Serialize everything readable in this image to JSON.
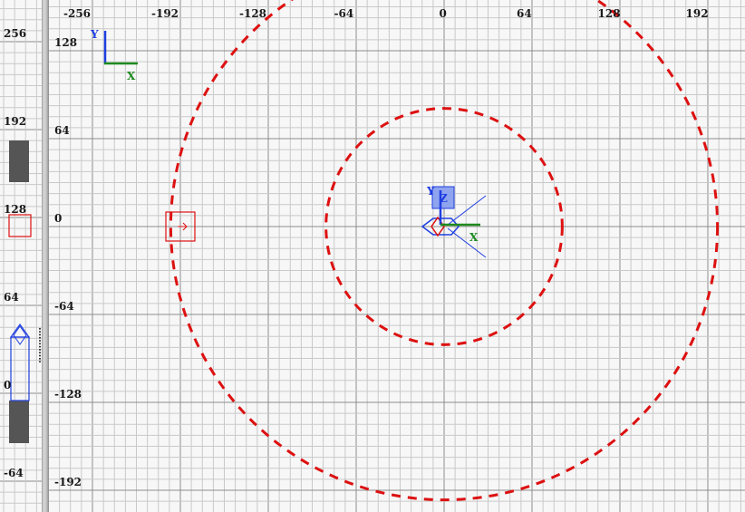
{
  "colors": {
    "background": "#f7f7f7",
    "minor_grid": "#c9c9c9",
    "major_grid": "#8c8c8c",
    "ring": "#dd1111",
    "camera": "#1f3fe0",
    "axis_y": "#1f3fe0",
    "axis_x": "#1f8a1f",
    "block": "#555555"
  },
  "main_view": {
    "x_ticks": [
      {
        "value": -256,
        "label": "-256"
      },
      {
        "value": -192,
        "label": "-192"
      },
      {
        "value": -128,
        "label": "-128"
      },
      {
        "value": -64,
        "label": "-64"
      },
      {
        "value": 0,
        "label": "0"
      },
      {
        "value": 64,
        "label": "64"
      },
      {
        "value": 128,
        "label": "128"
      },
      {
        "value": 192,
        "label": "192"
      }
    ],
    "y_ticks": [
      {
        "value": 128,
        "label": "128"
      },
      {
        "value": 64,
        "label": "64"
      },
      {
        "value": 0,
        "label": "0"
      },
      {
        "value": -64,
        "label": "-64"
      },
      {
        "value": -128,
        "label": "-128"
      },
      {
        "value": -192,
        "label": "-192"
      }
    ],
    "axis_legend": {
      "y": "Y",
      "x": "X"
    },
    "camera_axis": {
      "y": "Y",
      "x": "X",
      "z": "Z"
    },
    "inner_ring_radius": 86,
    "outer_ring_radius": 199,
    "light_position": [
      -192,
      0
    ]
  },
  "side_view": {
    "y_ticks": [
      {
        "value": 256,
        "label": "256"
      },
      {
        "value": 192,
        "label": "192"
      },
      {
        "value": 128,
        "label": "128"
      },
      {
        "value": 64,
        "label": "64"
      },
      {
        "value": 0,
        "label": "0"
      },
      {
        "value": -64,
        "label": "-64"
      }
    ]
  },
  "icons": {
    "light": "light-entity-icon",
    "camera": "camera-icon",
    "axis": "axis-gizmo-icon"
  }
}
